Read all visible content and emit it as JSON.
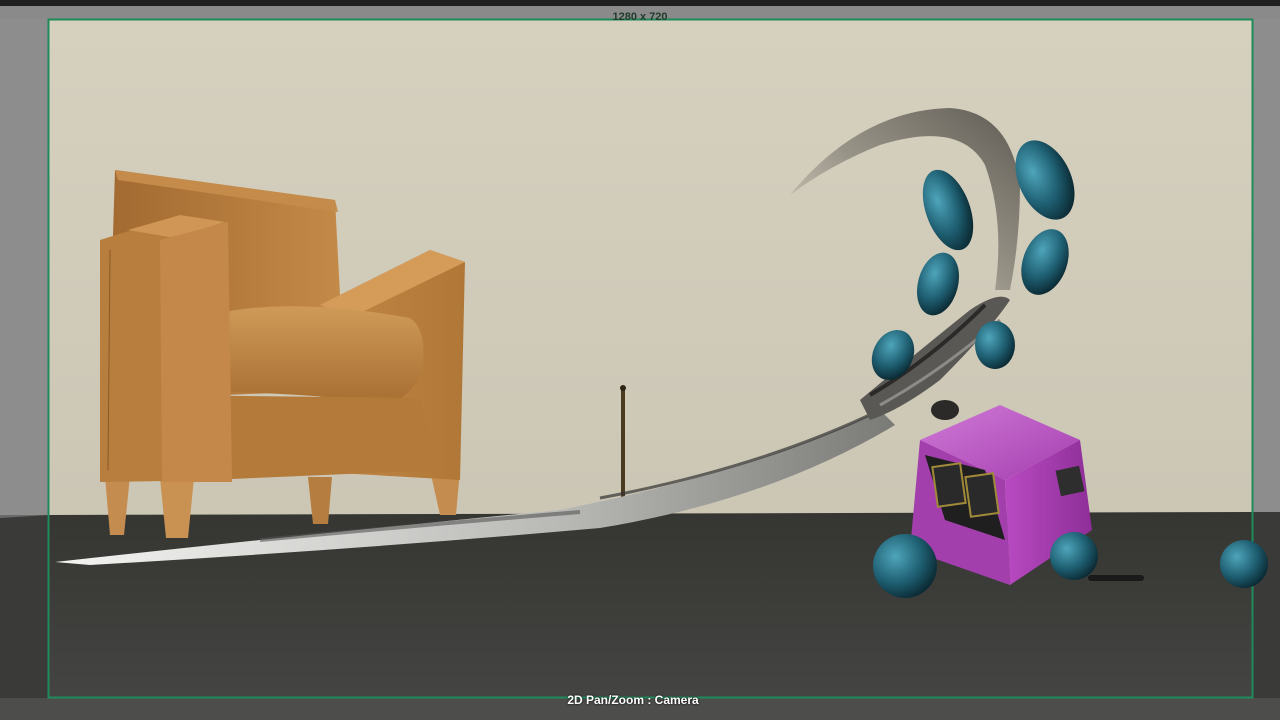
{
  "viewport": {
    "resolution_label": "1280 x 720",
    "hud_label": "2D Pan/Zoom : Camera",
    "gate_color": "#1f8a5a",
    "wall_color": "#cfc9b8",
    "floor_color": "#3e3f3c"
  },
  "scene": {
    "objects": [
      "armchair",
      "thin-pole",
      "ribbon-trail",
      "tentacle-limbs",
      "robot-cube",
      "robot-wheel"
    ],
    "colors": {
      "chair": "#b27a3c",
      "robot_body": "#b047b9",
      "spheres": "#1f5f72"
    }
  }
}
